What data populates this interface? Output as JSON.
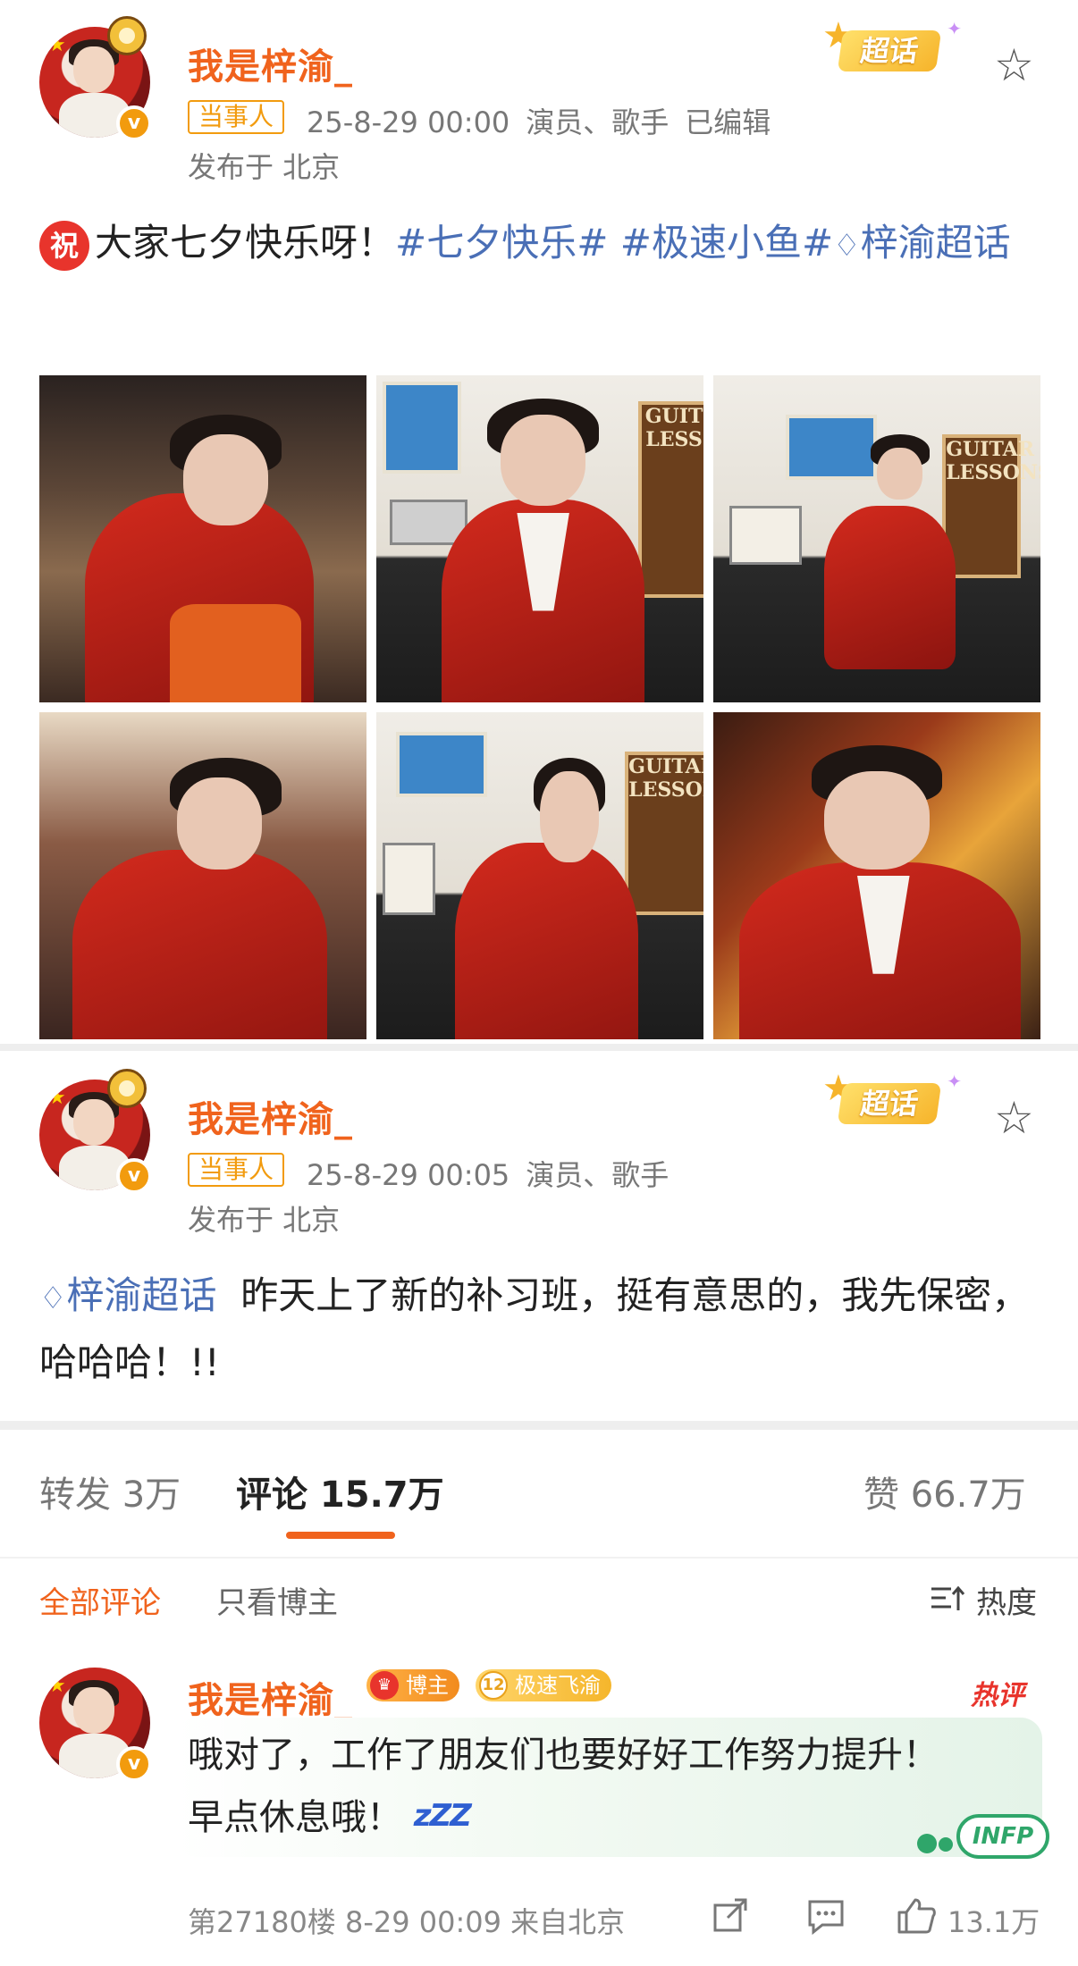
{
  "post1": {
    "username": "我是梓渝_",
    "tag": "当事人",
    "time": "25-8-29 00:00",
    "roles": "演员、歌手",
    "edited": "已编辑",
    "location": "发布于 北京",
    "chaohua_label": "超话",
    "text_prefix_badge": "祝",
    "text_main": "大家七夕快乐呀！",
    "hashtag1": "#七夕快乐#",
    "hashtag2": "#极速小鱼#",
    "topic_link": "梓渝超话"
  },
  "post2": {
    "username": "我是梓渝_",
    "tag": "当事人",
    "time": "25-8-29 00:05",
    "roles": "演员、歌手",
    "location": "发布于 北京",
    "chaohua_label": "超话",
    "topic_link": "梓渝超话",
    "text": "昨天上了新的补习班，挺有意思的，我先保密，哈哈哈！!!"
  },
  "tabs": {
    "repost": "转发 3万",
    "comments": "评论 15.7万",
    "likes": "赞 66.7万"
  },
  "filters": {
    "all": "全部评论",
    "author_only": "只看博主",
    "sort": "热度"
  },
  "comment": {
    "username": "我是梓渝_",
    "badge_author": "博主",
    "badge_fan_level": "12",
    "badge_fan": "极速飞渝",
    "hot": "热评",
    "text_line1": "哦对了，工作了朋友们也要好好工作努力提升！",
    "text_line2": "早点休息哦！",
    "zzz": "zZZ",
    "infp": "INFP",
    "floor_info": "第27180楼 8-29 00:09 来自北京",
    "likes": "13.1万"
  },
  "colors": {
    "accent_orange": "#f0631d",
    "link_blue": "#4a6fb6",
    "verify_gold": "#f29b0e"
  }
}
